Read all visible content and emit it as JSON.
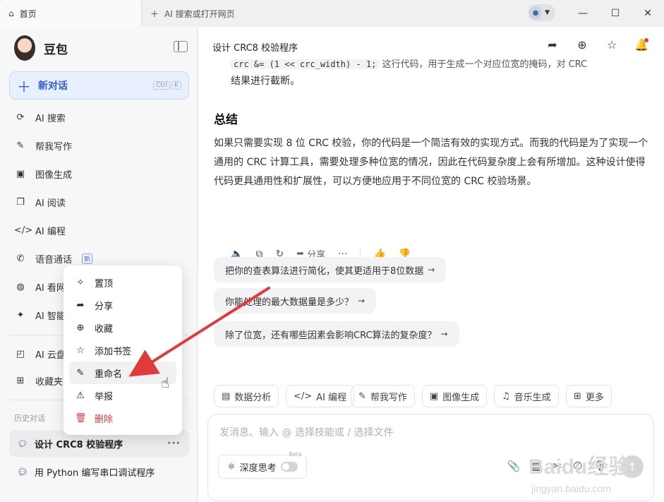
{
  "titlebar": {
    "tab_home": "首页",
    "tab_new": "AI 搜索或打开网页",
    "window_controls": {
      "minimize": "—",
      "maximize": "☐",
      "close": "✕"
    }
  },
  "sidebar": {
    "brand": "豆包",
    "new_chat": "新对话",
    "new_chat_shortcut": [
      "Ctrl",
      "K"
    ],
    "items": [
      {
        "label": "AI 搜索",
        "icon": "search-sparkle-icon"
      },
      {
        "label": "帮我写作",
        "icon": "pen-sparkle-icon"
      },
      {
        "label": "图像生成",
        "icon": "image-plus-icon"
      },
      {
        "label": "AI 阅读",
        "icon": "book-icon"
      },
      {
        "label": "AI 编程",
        "icon": "code-icon"
      },
      {
        "label": "语音通话",
        "icon": "phone-icon",
        "badge": "新"
      },
      {
        "label": "AI 看网",
        "icon": "globe-icon"
      },
      {
        "label": "AI 智能",
        "icon": "sparkle-icon"
      }
    ],
    "items2": [
      {
        "label": "AI 云盘",
        "icon": "cloud-drive-icon"
      },
      {
        "label": "收藏夹",
        "icon": "bookmark-add-icon"
      }
    ],
    "history_label": "历史对话",
    "history": [
      {
        "title": "设计 CRC8 校验程序",
        "active": true
      },
      {
        "title": "用 Python 编写串口调试程序",
        "active": false
      }
    ]
  },
  "context_menu": {
    "items": [
      {
        "label": "置顶",
        "icon": "pin-icon"
      },
      {
        "label": "分享",
        "icon": "share-icon"
      },
      {
        "label": "收藏",
        "icon": "collect-icon"
      },
      {
        "label": "添加书签",
        "icon": "star-icon"
      },
      {
        "label": "重命名",
        "icon": "edit-icon",
        "hover": true
      },
      {
        "label": "举报",
        "icon": "warning-icon"
      },
      {
        "label": "删除",
        "icon": "trash-icon",
        "danger": true
      }
    ]
  },
  "main": {
    "title": "设计 CRC8 校验程序",
    "code_line_prefix": "crc &= (1 << crc_width) - 1;",
    "code_line_suffix": "这行代码，用于生成一个对应位宽的掩码，对 CRC",
    "code_tail": "结果进行截断。",
    "summary_heading": "总结",
    "summary_text": "如果只需要实现 8 位 CRC 校验，你的代码是一个简洁有效的实现方式。而我的代码是为了实现一个通用的 CRC 计算工具，需要处理多种位宽的情况，因此在代码复杂度上会有所增加。这种设计使得代码更具通用性和扩展性，可以方便地应用于不同位宽的 CRC 校验场景。",
    "share_label": "分享",
    "suggestions": [
      "把你的查表算法进行简化，使其更适用于8位数据",
      "你能处理的最大数据量是多少？",
      "除了位宽，还有哪些因素会影响CRC算法的复杂度？"
    ],
    "tools": [
      {
        "label": "数据分析",
        "icon": "chart-icon"
      },
      {
        "label": "AI 编程",
        "icon": "code-icon"
      },
      {
        "label": "帮我写作",
        "icon": "pen-sparkle-icon"
      },
      {
        "label": "图像生成",
        "icon": "image-plus-icon"
      },
      {
        "label": "音乐生成",
        "icon": "music-icon"
      },
      {
        "label": "更多",
        "icon": "grid-icon"
      }
    ],
    "composer_placeholder": "发消息、输入 @ 选择技能或 / 选择文件",
    "deep_think": "深度思考",
    "beta": "Beta"
  },
  "watermark": {
    "brand": "Baidu经验",
    "url": "jingyan.baidu.com"
  }
}
